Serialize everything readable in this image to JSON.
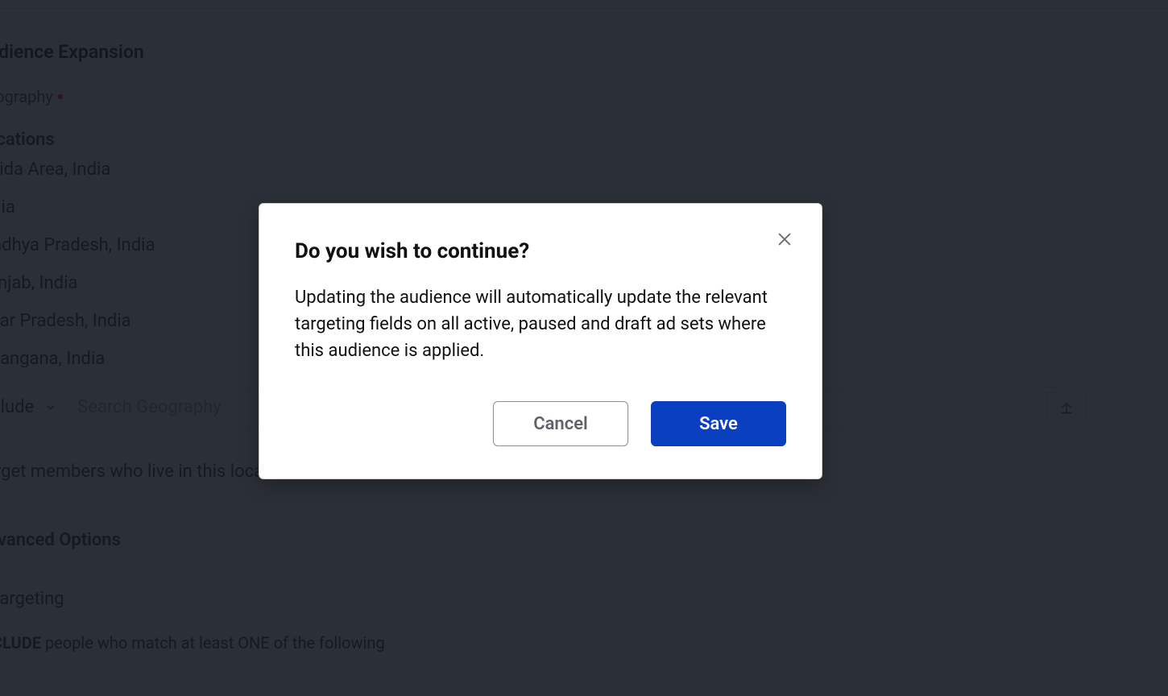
{
  "background": {
    "audience_expansion": "Audience Expansion",
    "geography_label": "Geography",
    "locations_header": "Locations",
    "locations": [
      "Noida Area, India",
      "India",
      "Madhya Pradesh, India",
      "Punjab, India",
      "Uttar Pradesh, India",
      "Telangana, India"
    ],
    "include_label": "Include",
    "search_placeholder": "Search Geography",
    "target_members_line": "Target members who live in this location",
    "advanced_options": "Advanced Options",
    "targeting_sub": "d Targeting",
    "include_rule_prefix": "INCLUDE",
    "include_rule_rest": " people who match at least ONE of the following"
  },
  "modal": {
    "title": "Do you wish to continue?",
    "body": "Updating the audience will automatically update the relevant targeting fields on all active, paused and draft ad sets where this audience is applied.",
    "cancel": "Cancel",
    "save": "Save"
  }
}
